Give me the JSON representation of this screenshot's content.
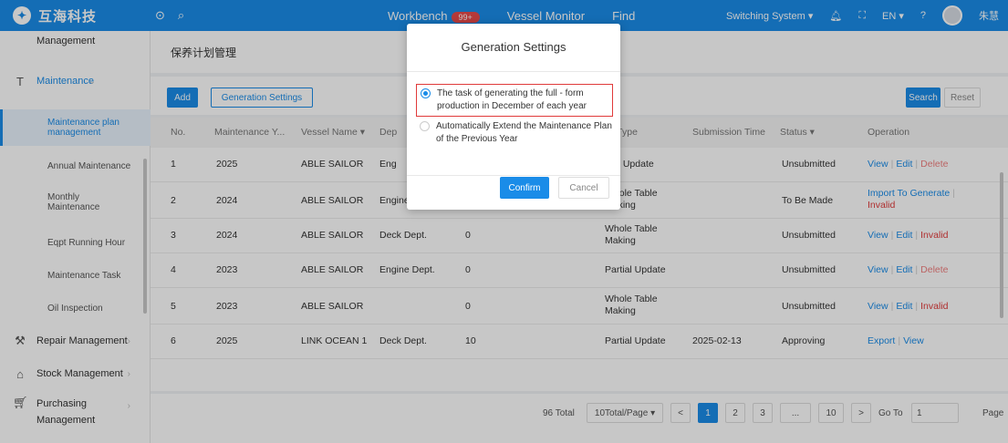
{
  "header": {
    "brand": "互海科技",
    "logo_icon": "hoi-logo",
    "nav": [
      {
        "label": "Workbench",
        "badge": "99+"
      },
      {
        "label": "Vessel Monitor"
      },
      {
        "label": "Find"
      }
    ],
    "switching": "Switching System ▾",
    "lang": "EN ▾",
    "user": "朱慧"
  },
  "sidebar": {
    "items": [
      {
        "label": "Management"
      },
      {
        "label": "Maintenance"
      },
      {
        "label": "Maintenance plan management"
      },
      {
        "label": "Annual Maintenance"
      },
      {
        "label": "Monthly Maintenance"
      },
      {
        "label": "Eqpt Running Hour"
      },
      {
        "label": "Maintenance Task"
      },
      {
        "label": "Oil Inspection"
      },
      {
        "label": "Repair Management"
      },
      {
        "label": "Stock Management"
      },
      {
        "label": "Purchasing Management"
      }
    ]
  },
  "page": {
    "breadcrumb": "保养计划管理",
    "add": "Add",
    "generation_settings": "Generation Settings",
    "search": "Search",
    "reset": "Reset"
  },
  "table": {
    "headers": [
      "No.",
      "Maintenance Y...",
      "Vessel Name ▾",
      "Dep",
      "",
      "ply Type",
      "Submission Time",
      "Status ▾",
      "Operation"
    ],
    "rows": [
      {
        "no": "1",
        "year": "2025",
        "vessel": "ABLE SAILOR",
        "dept": "Eng",
        "count": "",
        "type": "rtial Update",
        "time": "",
        "status": "Unsubmitted",
        "ops": [
          "View",
          "Edit",
          "Delete"
        ]
      },
      {
        "no": "2",
        "year": "2024",
        "vessel": "ABLE SAILOR",
        "dept": "Engine Dept.",
        "count": "0",
        "type": "Whole Table Making",
        "time": "",
        "status": "To Be Made",
        "ops": [
          "Import To Generate",
          "Invalid"
        ]
      },
      {
        "no": "3",
        "year": "2024",
        "vessel": "ABLE SAILOR",
        "dept": "Deck Dept.",
        "count": "0",
        "type": "Whole Table Making",
        "time": "",
        "status": "Unsubmitted",
        "ops": [
          "View",
          "Edit",
          "Invalid"
        ]
      },
      {
        "no": "4",
        "year": "2023",
        "vessel": "ABLE SAILOR",
        "dept": "Engine Dept.",
        "count": "0",
        "type": "Partial Update",
        "time": "",
        "status": "Unsubmitted",
        "ops": [
          "View",
          "Edit",
          "Delete"
        ]
      },
      {
        "no": "5",
        "year": "2023",
        "vessel": "ABLE SAILOR",
        "dept": "",
        "count": "0",
        "type": "Whole Table Making",
        "time": "",
        "status": "Unsubmitted",
        "ops": [
          "View",
          "Edit",
          "Invalid"
        ]
      },
      {
        "no": "6",
        "year": "2025",
        "vessel": "LINK OCEAN 1",
        "dept": "Deck Dept.",
        "count": "10",
        "type": "Partial Update",
        "time": "2025-02-13",
        "status": "Approving",
        "ops": [
          "Export",
          "View"
        ]
      }
    ]
  },
  "pager": {
    "total": "96 Total",
    "per_page": "10Total/Page ▾",
    "prev": "<",
    "pages": [
      "1",
      "2",
      "3",
      "...",
      "10"
    ],
    "next": ">",
    "goto": "Go To",
    "goto_value": "1",
    "page_label": "Page"
  },
  "modal": {
    "title": "Generation Settings",
    "option1": "The task of generating the full - form production in December of each year",
    "option2": "Automatically Extend the Maintenance Plan of the Previous Year",
    "confirm": "Confirm",
    "cancel": "Cancel"
  }
}
